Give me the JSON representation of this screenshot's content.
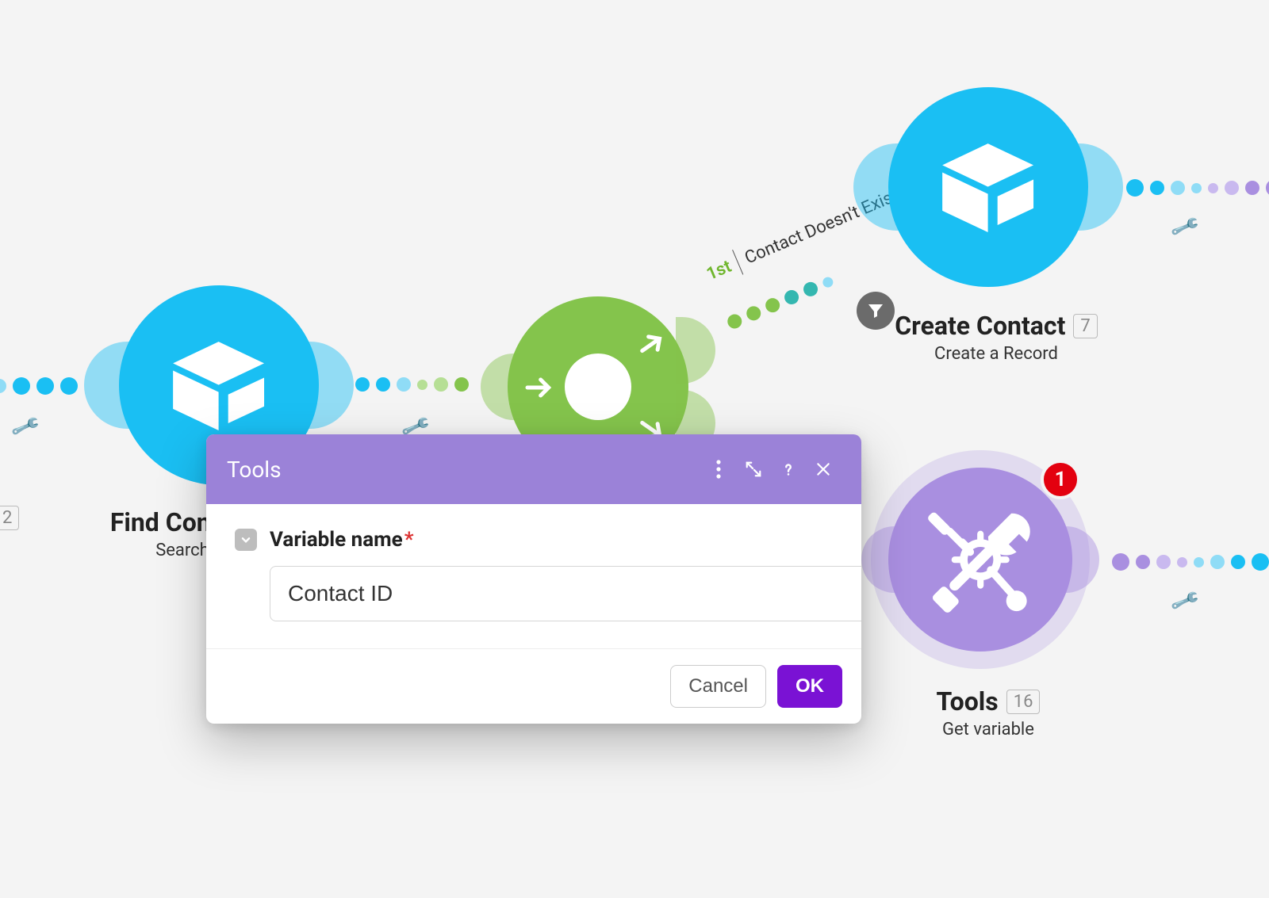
{
  "colors": {
    "blue": "#1abff3",
    "green": "#84c44c",
    "purple": "#a98fe0",
    "ok": "#7a12d4",
    "badge": "#e3000f"
  },
  "nodes": {
    "find_contact": {
      "title": "Find Contact",
      "subtitle": "Search",
      "index": "2"
    },
    "router": {
      "route_order": "1st",
      "route_label": "Contact Doesn't Exist"
    },
    "create_contact": {
      "title": "Create Contact",
      "subtitle": "Create a Record",
      "index": "7"
    },
    "tools": {
      "title": "Tools",
      "subtitle": "Get variable",
      "index": "16",
      "badge": "1"
    }
  },
  "dialog": {
    "title": "Tools",
    "field_label": "Variable name",
    "field_value": "Contact ID",
    "required_mark": "*",
    "cancel_label": "Cancel",
    "ok_label": "OK"
  }
}
